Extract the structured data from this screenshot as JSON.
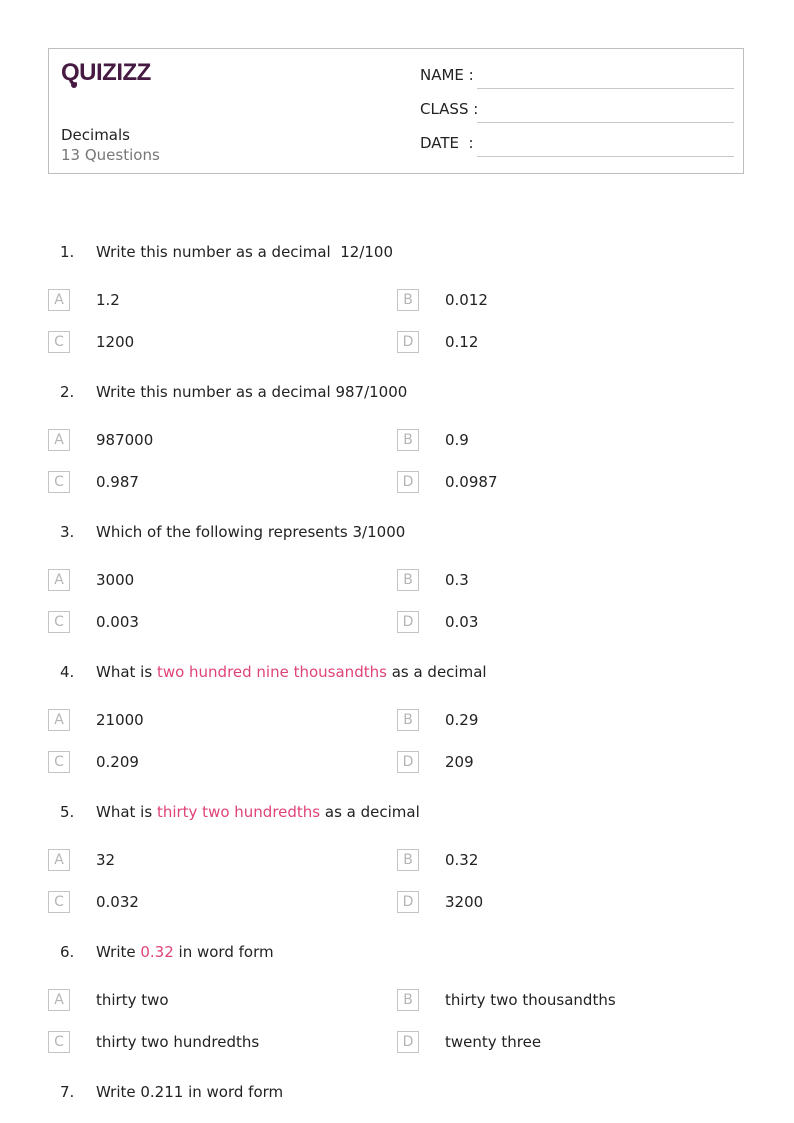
{
  "header": {
    "logo": "Quizizz",
    "title": "Decimals",
    "question_count": "13 Questions",
    "fields": [
      {
        "label": "NAME :"
      },
      {
        "label": "CLASS :"
      },
      {
        "label": "DATE  :"
      }
    ]
  },
  "colors": {
    "brand": "#461a42",
    "highlight": "#e0437a"
  },
  "questions": [
    {
      "number": "1.",
      "text_parts": [
        {
          "text": "Write this number as a decimal  12/100",
          "highlight": false
        }
      ],
      "options": [
        {
          "letter": "A",
          "text": "1.2"
        },
        {
          "letter": "B",
          "text": "0.012"
        },
        {
          "letter": "C",
          "text": "1200"
        },
        {
          "letter": "D",
          "text": "0.12"
        }
      ]
    },
    {
      "number": "2.",
      "text_parts": [
        {
          "text": "Write this number as a decimal 987/1000",
          "highlight": false
        }
      ],
      "options": [
        {
          "letter": "A",
          "text": "987000"
        },
        {
          "letter": "B",
          "text": "0.9"
        },
        {
          "letter": "C",
          "text": "0.987"
        },
        {
          "letter": "D",
          "text": "0.0987"
        }
      ]
    },
    {
      "number": "3.",
      "text_parts": [
        {
          "text": "Which of the following represents 3/1000",
          "highlight": false
        }
      ],
      "options": [
        {
          "letter": "A",
          "text": "3000"
        },
        {
          "letter": "B",
          "text": "0.3"
        },
        {
          "letter": "C",
          "text": "0.003"
        },
        {
          "letter": "D",
          "text": "0.03"
        }
      ]
    },
    {
      "number": "4.",
      "text_parts": [
        {
          "text": "What is ",
          "highlight": false
        },
        {
          "text": "two hundred nine thousandths",
          "highlight": true
        },
        {
          "text": " as a decimal",
          "highlight": false
        }
      ],
      "options": [
        {
          "letter": "A",
          "text": "21000"
        },
        {
          "letter": "B",
          "text": "0.29"
        },
        {
          "letter": "C",
          "text": "0.209"
        },
        {
          "letter": "D",
          "text": "209"
        }
      ]
    },
    {
      "number": "5.",
      "text_parts": [
        {
          "text": "What is ",
          "highlight": false
        },
        {
          "text": "thirty two hundredths",
          "highlight": true
        },
        {
          "text": " as a decimal",
          "highlight": false
        }
      ],
      "options": [
        {
          "letter": "A",
          "text": "32"
        },
        {
          "letter": "B",
          "text": "0.32"
        },
        {
          "letter": "C",
          "text": "0.032"
        },
        {
          "letter": "D",
          "text": "3200"
        }
      ]
    },
    {
      "number": "6.",
      "text_parts": [
        {
          "text": "Write ",
          "highlight": false
        },
        {
          "text": "0.32",
          "highlight": true
        },
        {
          "text": " in word form",
          "highlight": false
        }
      ],
      "options": [
        {
          "letter": "A",
          "text": "thirty two"
        },
        {
          "letter": "B",
          "text": "thirty two thousandths"
        },
        {
          "letter": "C",
          "text": "thirty two hundredths"
        },
        {
          "letter": "D",
          "text": "twenty three"
        }
      ]
    },
    {
      "number": "7.",
      "text_parts": [
        {
          "text": "Write 0.211 in word form",
          "highlight": false
        }
      ],
      "options": []
    }
  ]
}
